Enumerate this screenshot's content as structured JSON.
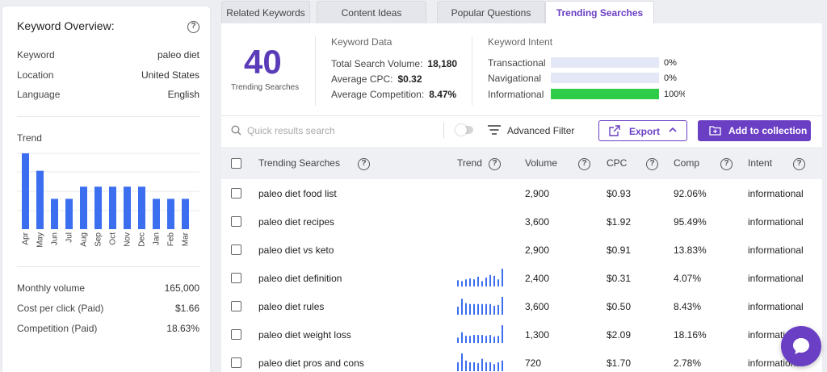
{
  "overview": {
    "title": "Keyword Overview:",
    "fields": [
      {
        "label": "Keyword",
        "value": "paleo diet"
      },
      {
        "label": "Location",
        "value": "United States"
      },
      {
        "label": "Language",
        "value": "English"
      }
    ],
    "trend_label": "Trend",
    "trend_months": [
      "Apr",
      "May",
      "Jun",
      "Jul",
      "Aug",
      "Sep",
      "Oct",
      "Nov",
      "Dec",
      "Jan",
      "Feb",
      "Mar"
    ],
    "trend_levels": [
      1.0,
      0.77,
      0.4,
      0.4,
      0.56,
      0.56,
      0.56,
      0.56,
      0.56,
      0.4,
      0.4,
      0.4
    ],
    "stats": [
      {
        "label": "Monthly volume",
        "value": "165,000"
      },
      {
        "label": "Cost per click (Paid)",
        "value": "$1.66"
      },
      {
        "label": "Competition (Paid)",
        "value": "18.63%"
      }
    ]
  },
  "tabs": [
    {
      "label": "Related Keywords",
      "active": false
    },
    {
      "label": "Content Ideas",
      "active": false
    },
    {
      "label": "Popular Questions",
      "active": false
    },
    {
      "label": "Trending Searches",
      "active": true
    }
  ],
  "summary": {
    "count": "40",
    "count_label": "Trending Searches",
    "keyword_data_title": "Keyword Data",
    "keyword_data": [
      {
        "label": "Total Search Volume:",
        "value": "18,180"
      },
      {
        "label": "Average CPC:",
        "value": "$0.32"
      },
      {
        "label": "Average Competition:",
        "value": "8.47%"
      }
    ],
    "intent_title": "Keyword Intent",
    "intents": [
      {
        "label": "Transactional",
        "pct": "0%",
        "level": 0
      },
      {
        "label": "Navigational",
        "pct": "0%",
        "level": 0
      },
      {
        "label": "Informational",
        "pct": "100%",
        "level": 100
      }
    ]
  },
  "toolbar": {
    "search_placeholder": "Quick results search",
    "advanced_filter": "Advanced Filter",
    "export": "Export",
    "add_to_collection": "Add to collection"
  },
  "table": {
    "headers": [
      "Trending Searches",
      "Trend",
      "Volume",
      "CPC",
      "Comp",
      "Intent"
    ],
    "rows": [
      {
        "keyword": "paleo diet food list",
        "trend": [],
        "volume": "2,900",
        "cpc": "$0.93",
        "comp": "92.06%",
        "intent": "informational"
      },
      {
        "keyword": "paleo diet recipes",
        "trend": [],
        "volume": "3,600",
        "cpc": "$1.92",
        "comp": "95.49%",
        "intent": "informational"
      },
      {
        "keyword": "paleo diet vs keto",
        "trend": [],
        "volume": "2,900",
        "cpc": "$0.91",
        "comp": "13.83%",
        "intent": "informational"
      },
      {
        "keyword": "paleo diet definition",
        "trend": [
          0.35,
          0.3,
          0.4,
          0.45,
          0.4,
          0.55,
          0.3,
          0.5,
          0.65,
          0.6,
          0.4,
          1.0
        ],
        "volume": "2,400",
        "cpc": "$0.31",
        "comp": "4.07%",
        "intent": "informational"
      },
      {
        "keyword": "paleo diet rules",
        "trend": [
          0.45,
          0.9,
          0.65,
          0.6,
          0.6,
          0.6,
          0.6,
          0.6,
          0.6,
          0.5,
          0.55,
          1.0
        ],
        "volume": "3,600",
        "cpc": "$0.50",
        "comp": "8.43%",
        "intent": "informational"
      },
      {
        "keyword": "paleo diet weight loss",
        "trend": [
          0.3,
          0.6,
          0.4,
          0.4,
          0.45,
          0.45,
          0.45,
          0.4,
          0.45,
          0.35,
          0.4,
          1.0
        ],
        "volume": "1,300",
        "cpc": "$2.09",
        "comp": "18.16%",
        "intent": "informational"
      },
      {
        "keyword": "paleo diet pros and cons",
        "trend": [
          0.5,
          1.0,
          0.6,
          0.5,
          0.5,
          0.45,
          0.7,
          0.5,
          0.5,
          0.4,
          0.5,
          0.6
        ],
        "volume": "720",
        "cpc": "$1.70",
        "comp": "2.78%",
        "intent": "informational"
      }
    ]
  },
  "colors": {
    "accent": "#6a3fc4",
    "bar": "#3b6ff0",
    "intent_fill": "#2ecc48"
  }
}
